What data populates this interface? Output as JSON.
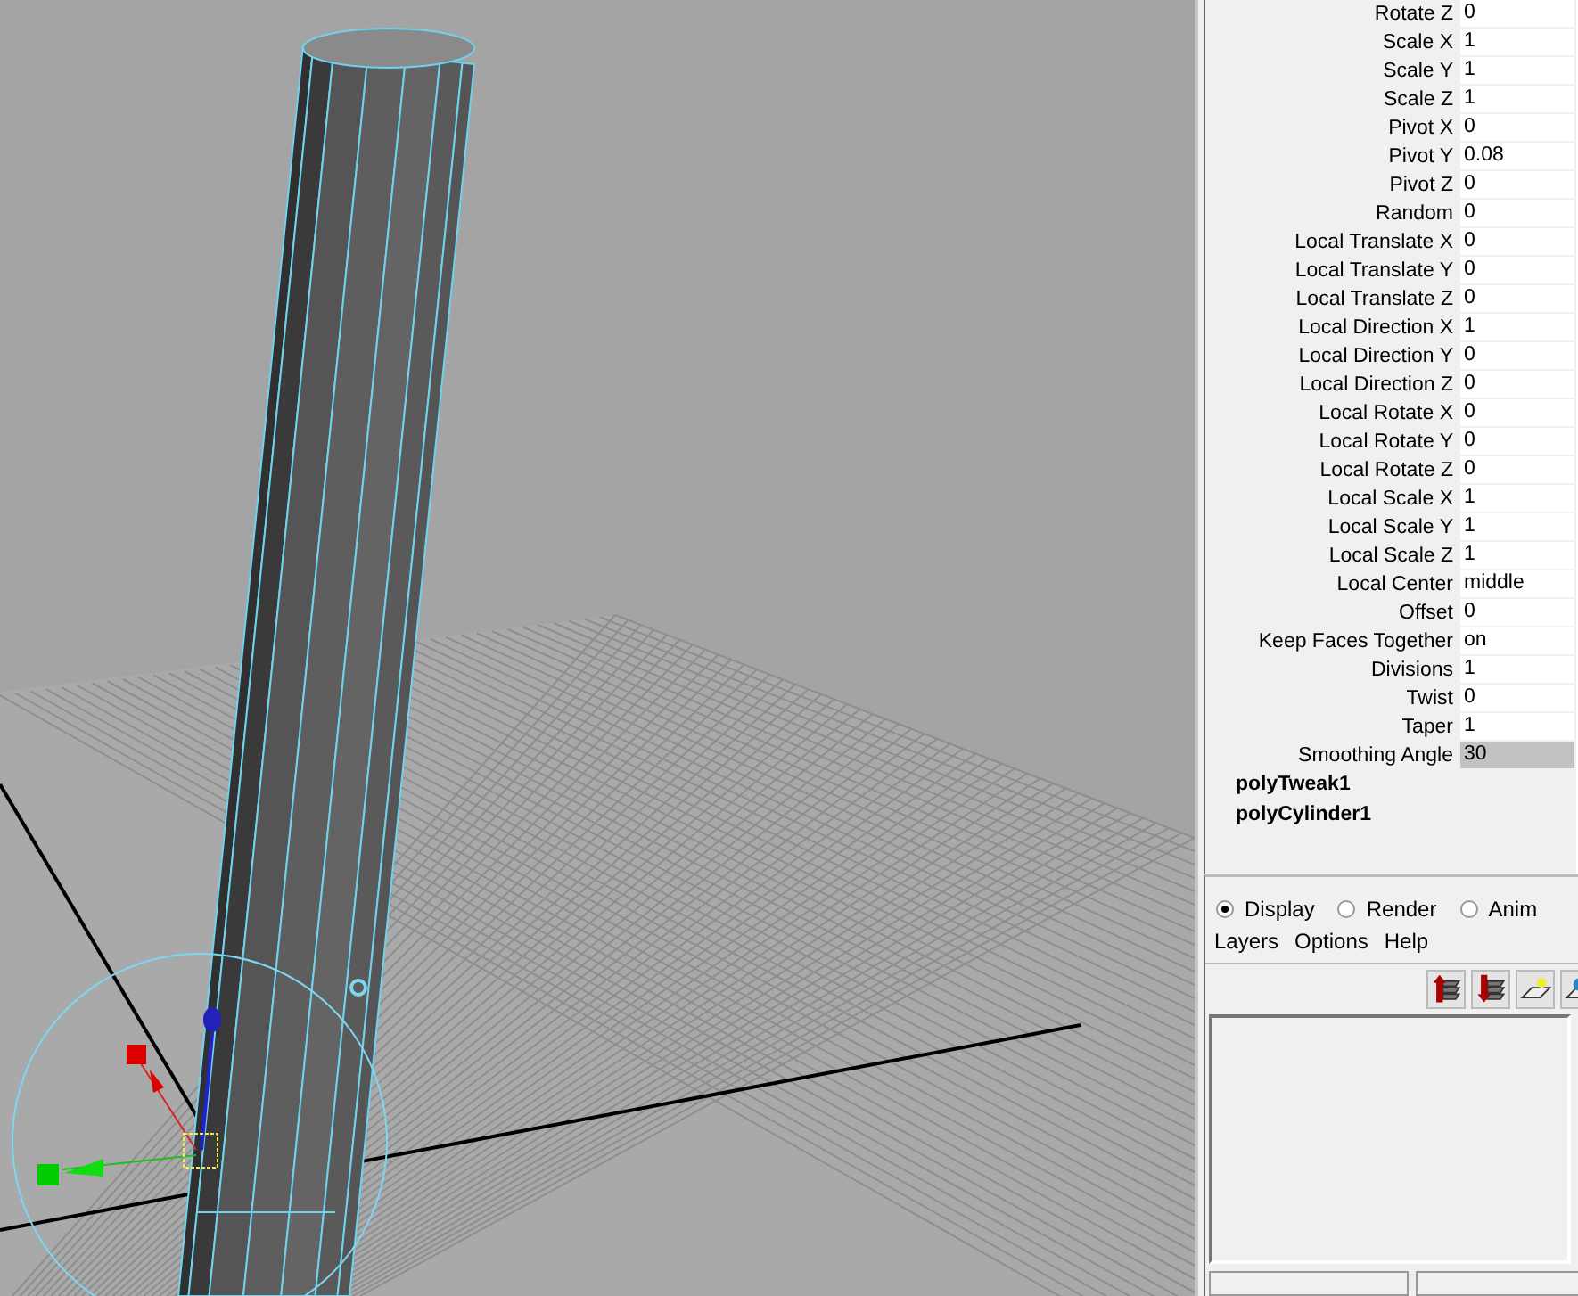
{
  "attributes": [
    {
      "label": "Rotate Z",
      "value": "0",
      "selected": false
    },
    {
      "label": "Scale X",
      "value": "1",
      "selected": false
    },
    {
      "label": "Scale Y",
      "value": "1",
      "selected": false
    },
    {
      "label": "Scale Z",
      "value": "1",
      "selected": false
    },
    {
      "label": "Pivot X",
      "value": "0",
      "selected": false
    },
    {
      "label": "Pivot Y",
      "value": "0.08",
      "selected": false
    },
    {
      "label": "Pivot Z",
      "value": "0",
      "selected": false
    },
    {
      "label": "Random",
      "value": "0",
      "selected": false
    },
    {
      "label": "Local Translate X",
      "value": "0",
      "selected": false
    },
    {
      "label": "Local Translate Y",
      "value": "0",
      "selected": false
    },
    {
      "label": "Local Translate Z",
      "value": "0",
      "selected": false
    },
    {
      "label": "Local Direction X",
      "value": "1",
      "selected": false
    },
    {
      "label": "Local Direction Y",
      "value": "0",
      "selected": false
    },
    {
      "label": "Local Direction Z",
      "value": "0",
      "selected": false
    },
    {
      "label": "Local Rotate X",
      "value": "0",
      "selected": false
    },
    {
      "label": "Local Rotate Y",
      "value": "0",
      "selected": false
    },
    {
      "label": "Local Rotate Z",
      "value": "0",
      "selected": false
    },
    {
      "label": "Local Scale X",
      "value": "1",
      "selected": false
    },
    {
      "label": "Local Scale Y",
      "value": "1",
      "selected": false
    },
    {
      "label": "Local Scale Z",
      "value": "1",
      "selected": false
    },
    {
      "label": "Local Center",
      "value": "middle",
      "selected": false
    },
    {
      "label": "Offset",
      "value": "0",
      "selected": false
    },
    {
      "label": "Keep Faces Together",
      "value": "on",
      "selected": false
    },
    {
      "label": "Divisions",
      "value": "1",
      "selected": false
    },
    {
      "label": "Twist",
      "value": "0",
      "selected": false
    },
    {
      "label": "Taper",
      "value": "1",
      "selected": false
    },
    {
      "label": "Smoothing Angle",
      "value": "30",
      "selected": true
    }
  ],
  "nodes": [
    "polyTweak1",
    "polyCylinder1"
  ],
  "layer_editor": {
    "modes": [
      {
        "label": "Display",
        "selected": true
      },
      {
        "label": "Render",
        "selected": false
      },
      {
        "label": "Anim",
        "selected": false
      }
    ],
    "menus": [
      "Layers",
      "Options",
      "Help"
    ]
  }
}
